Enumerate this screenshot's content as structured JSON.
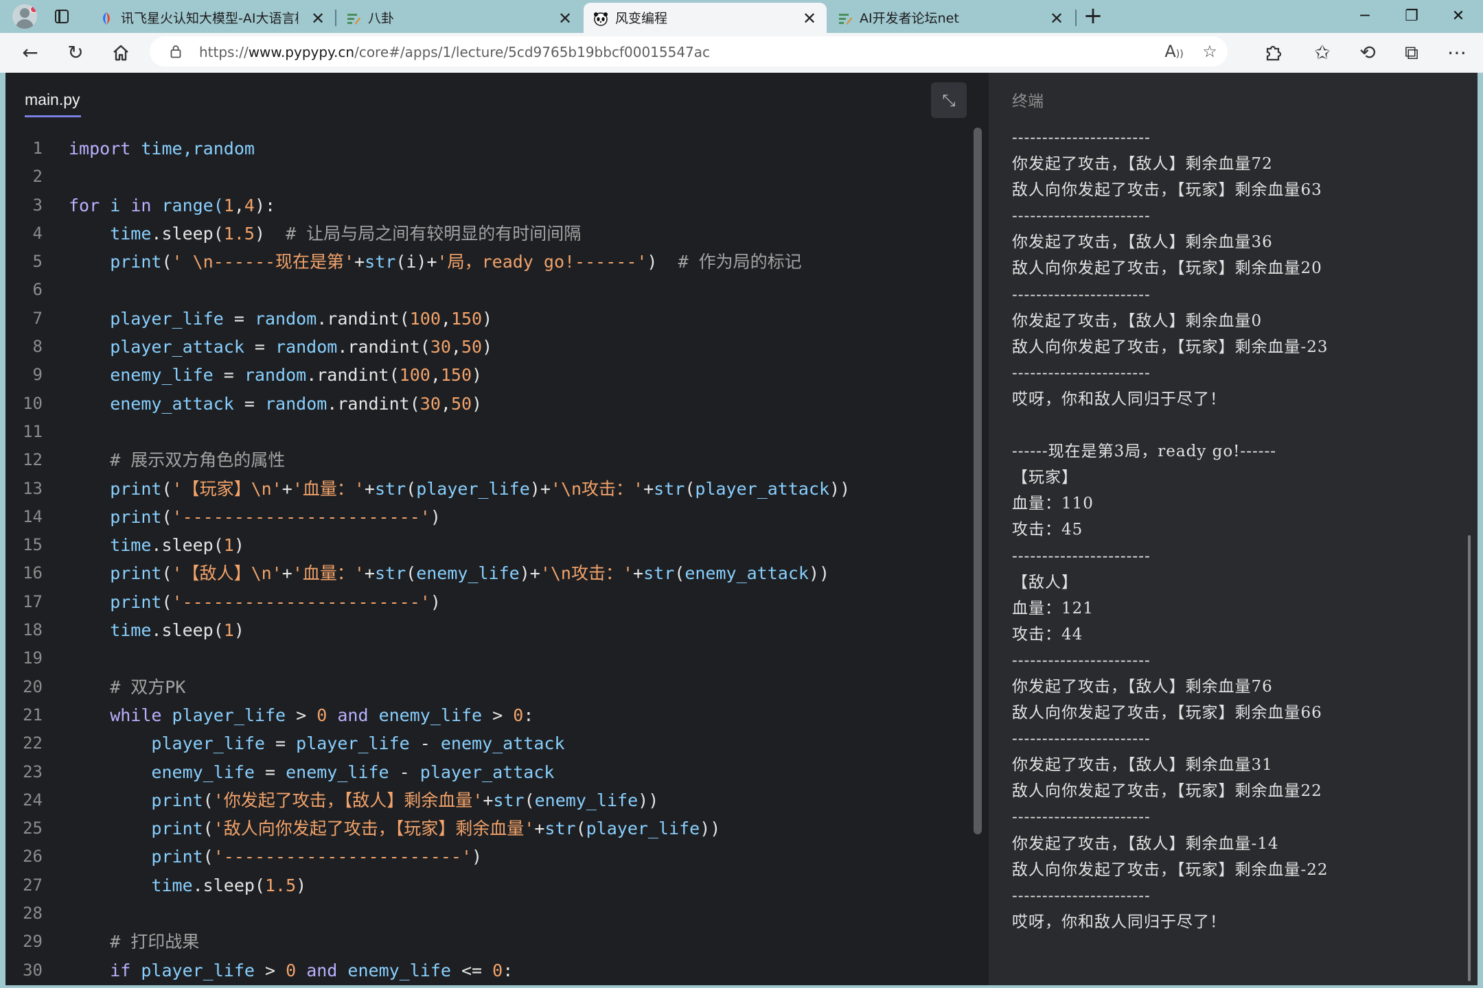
{
  "browser": {
    "tabs": [
      {
        "label": "讯飞星火认知大模型-AI大语言模",
        "active": false,
        "icon": "spark-icon"
      },
      {
        "label": "八卦",
        "active": false,
        "icon": "forum-icon"
      },
      {
        "label": "风变编程",
        "active": true,
        "icon": "panda-icon"
      },
      {
        "label": "AI开发者论坛net",
        "active": false,
        "icon": "forum-icon"
      }
    ],
    "url_prefix": "https://",
    "url_host": "www.pypypy.cn",
    "url_path": "/core#/apps/1/lecture/5cd9765b19bbcf00015547ac",
    "read_aloud_glyph": "A"
  },
  "editor": {
    "file_name": "main.py",
    "lines": [
      "1",
      "2",
      "3",
      "4",
      "5",
      "6",
      "7",
      "8",
      "9",
      "10",
      "11",
      "12",
      "13",
      "14",
      "15",
      "16",
      "17",
      "18",
      "19",
      "20",
      "21",
      "22",
      "23",
      "24",
      "25",
      "26",
      "27",
      "28",
      "29",
      "30"
    ],
    "code": {
      "l1_a": "import",
      "l1_b": " time,random",
      "l3_a": "for",
      "l3_b": " i ",
      "l3_c": "in",
      "l3_d": " range(",
      "l3_e": "1",
      "l3_f": ",",
      "l3_g": "4",
      "l3_h": "):",
      "l4_a": "    time",
      "l4_b": ".sleep(",
      "l4_c": "1.5",
      "l4_d": ")  ",
      "l4_e": "# 让局与局之间有较明显的有时间间隔",
      "l5_a": "    print",
      "l5_b": "(",
      "l5_c": "' \\n------现在是第'",
      "l5_d": "+",
      "l5_e": "str",
      "l5_f": "(i)+",
      "l5_g": "'局，ready go!------'",
      "l5_h": ")  ",
      "l5_i": "# 作为局的标记",
      "l7_a": "    player_life",
      "l7_b": " = ",
      "l7_c": "random",
      "l7_d": ".randint(",
      "l7_e": "100",
      "l7_f": ",",
      "l7_g": "150",
      "l7_h": ")",
      "l8_a": "    player_attack",
      "l8_b": " = ",
      "l8_c": "random",
      "l8_d": ".randint(",
      "l8_e": "30",
      "l8_f": ",",
      "l8_g": "50",
      "l8_h": ")",
      "l9_a": "    enemy_life",
      "l9_b": " = ",
      "l9_c": "random",
      "l9_d": ".randint(",
      "l9_e": "100",
      "l9_f": ",",
      "l9_g": "150",
      "l9_h": ")",
      "l10_a": "    enemy_attack",
      "l10_b": " = ",
      "l10_c": "random",
      "l10_d": ".randint(",
      "l10_e": "30",
      "l10_f": ",",
      "l10_g": "50",
      "l10_h": ")",
      "l12_a": "    # 展示双方角色的属性",
      "l13_a": "    print",
      "l13_b": "(",
      "l13_c": "'【玩家】\\n'",
      "l13_d": "+",
      "l13_e": "'血量：'",
      "l13_f": "+",
      "l13_g": "str",
      "l13_h": "(",
      "l13_i": "player_life",
      "l13_j": ")+",
      "l13_k": "'\\n攻击：'",
      "l13_l": "+",
      "l13_m": "str",
      "l13_n": "(",
      "l13_o": "player_attack",
      "l13_p": "))",
      "l14_a": "    print",
      "l14_b": "(",
      "l14_c": "'-----------------------'",
      "l14_d": ")",
      "l15_a": "    time",
      "l15_b": ".sleep(",
      "l15_c": "1",
      "l15_d": ")",
      "l16_a": "    print",
      "l16_b": "(",
      "l16_c": "'【敌人】\\n'",
      "l16_d": "+",
      "l16_e": "'血量：'",
      "l16_f": "+",
      "l16_g": "str",
      "l16_h": "(",
      "l16_i": "enemy_life",
      "l16_j": ")+",
      "l16_k": "'\\n攻击：'",
      "l16_l": "+",
      "l16_m": "str",
      "l16_n": "(",
      "l16_o": "enemy_attack",
      "l16_p": "))",
      "l17_a": "    print",
      "l17_b": "(",
      "l17_c": "'-----------------------'",
      "l17_d": ")",
      "l18_a": "    time",
      "l18_b": ".sleep(",
      "l18_c": "1",
      "l18_d": ")",
      "l20_a": "    # 双方PK",
      "l21_a": "    while",
      "l21_b": " player_life",
      "l21_c": " > ",
      "l21_d": "0",
      "l21_e": " and",
      "l21_f": " enemy_life",
      "l21_g": " > ",
      "l21_h": "0",
      "l21_i": ":",
      "l22_a": "        player_life",
      "l22_b": " = ",
      "l22_c": "player_life",
      "l22_d": " - ",
      "l22_e": "enemy_attack",
      "l23_a": "        enemy_life",
      "l23_b": " = ",
      "l23_c": "enemy_life",
      "l23_d": " - ",
      "l23_e": "player_attack",
      "l24_a": "        print",
      "l24_b": "(",
      "l24_c": "'你发起了攻击，【敌人】剩余血量'",
      "l24_d": "+",
      "l24_e": "str",
      "l24_f": "(",
      "l24_g": "enemy_life",
      "l24_h": "))",
      "l25_a": "        print",
      "l25_b": "(",
      "l25_c": "'敌人向你发起了攻击，【玩家】剩余血量'",
      "l25_d": "+",
      "l25_e": "str",
      "l25_f": "(",
      "l25_g": "player_life",
      "l25_h": "))",
      "l26_a": "        print",
      "l26_b": "(",
      "l26_c": "'-----------------------'",
      "l26_d": ")",
      "l27_a": "        time",
      "l27_b": ".sleep(",
      "l27_c": "1.5",
      "l27_d": ")",
      "l29_a": "    # 打印战果",
      "l30_a": "    if",
      "l30_b": " player_life",
      "l30_c": " > ",
      "l30_d": "0",
      "l30_e": " and",
      "l30_f": " enemy_life",
      "l30_g": " <= ",
      "l30_h": "0",
      "l30_i": ":"
    }
  },
  "terminal": {
    "title": "终端",
    "lines": [
      "-----------------------",
      "你发起了攻击，【敌人】剩余血量72",
      "敌人向你发起了攻击，【玩家】剩余血量63",
      "-----------------------",
      "你发起了攻击，【敌人】剩余血量36",
      "敌人向你发起了攻击，【玩家】剩余血量20",
      "-----------------------",
      "你发起了攻击，【敌人】剩余血量0",
      "敌人向你发起了攻击，【玩家】剩余血量-23",
      "-----------------------",
      "哎呀，你和敌人同归于尽了！",
      "",
      "------现在是第3局，ready go!------",
      "【玩家】",
      "血量：110",
      "攻击：45",
      "-----------------------",
      "【敌人】",
      "血量：121",
      "攻击：44",
      "-----------------------",
      "你发起了攻击，【敌人】剩余血量76",
      "敌人向你发起了攻击，【玩家】剩余血量66",
      "-----------------------",
      "你发起了攻击，【敌人】剩余血量31",
      "敌人向你发起了攻击，【玩家】剩余血量22",
      "-----------------------",
      "你发起了攻击，【敌人】剩余血量-14",
      "敌人向你发起了攻击，【玩家】剩余血量-22",
      "-----------------------",
      "哎呀，你和敌人同归于尽了！"
    ]
  }
}
